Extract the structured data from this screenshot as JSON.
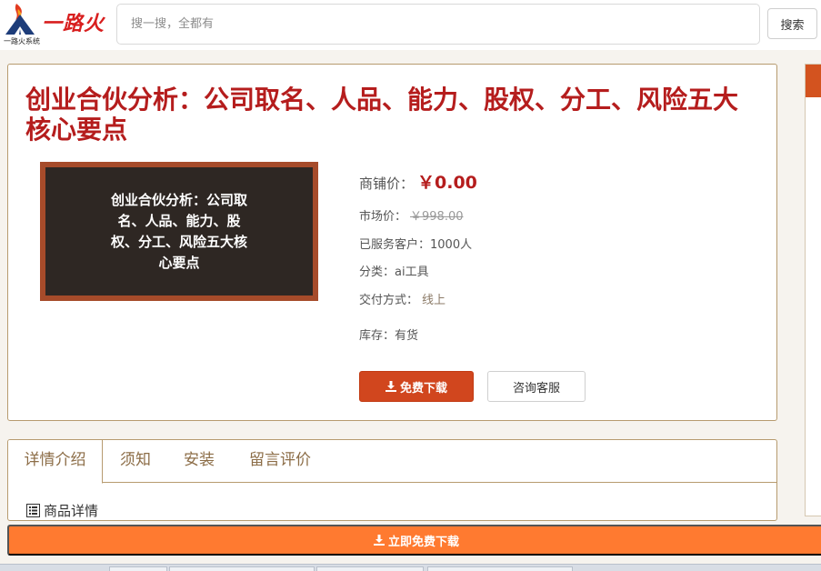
{
  "header": {
    "logo_text": "一路火",
    "logo_subtitle": "一路火系统",
    "search_placeholder": "搜一搜，全都有",
    "search_button": "搜索"
  },
  "product": {
    "title": "创业合伙分析：公司取名、人品、能力、股权、分工、风险五大核心要点",
    "thumbnail_text": "创业合伙分析：公司取名、人品、能力、股权、分工、风险五大核心要点",
    "shop_price_label": "商铺价：",
    "shop_price": "￥0.00",
    "market_price_label": "市场价：",
    "market_price": "￥998.00",
    "customers": "已服务客户：1000人",
    "category": "分类：ai工具",
    "delivery_label": "交付方式：",
    "delivery_value": "线上",
    "stock": "库存：有货",
    "download_button": "免费下载",
    "service_button": "咨询客服"
  },
  "tabs": {
    "items": [
      "详情介绍",
      "须知",
      "安装",
      "留言评价"
    ],
    "active": "详情介绍",
    "section_label": "商品详情"
  },
  "bottom": {
    "download_now": "立即免费下载"
  },
  "colors": {
    "accent_red": "#b51d1d",
    "button_red": "#d1461e",
    "bottom_orange": "#ff7a30",
    "border_tan": "#b79b6f"
  },
  "icons": {
    "download": "download-icon",
    "list": "list-icon"
  }
}
